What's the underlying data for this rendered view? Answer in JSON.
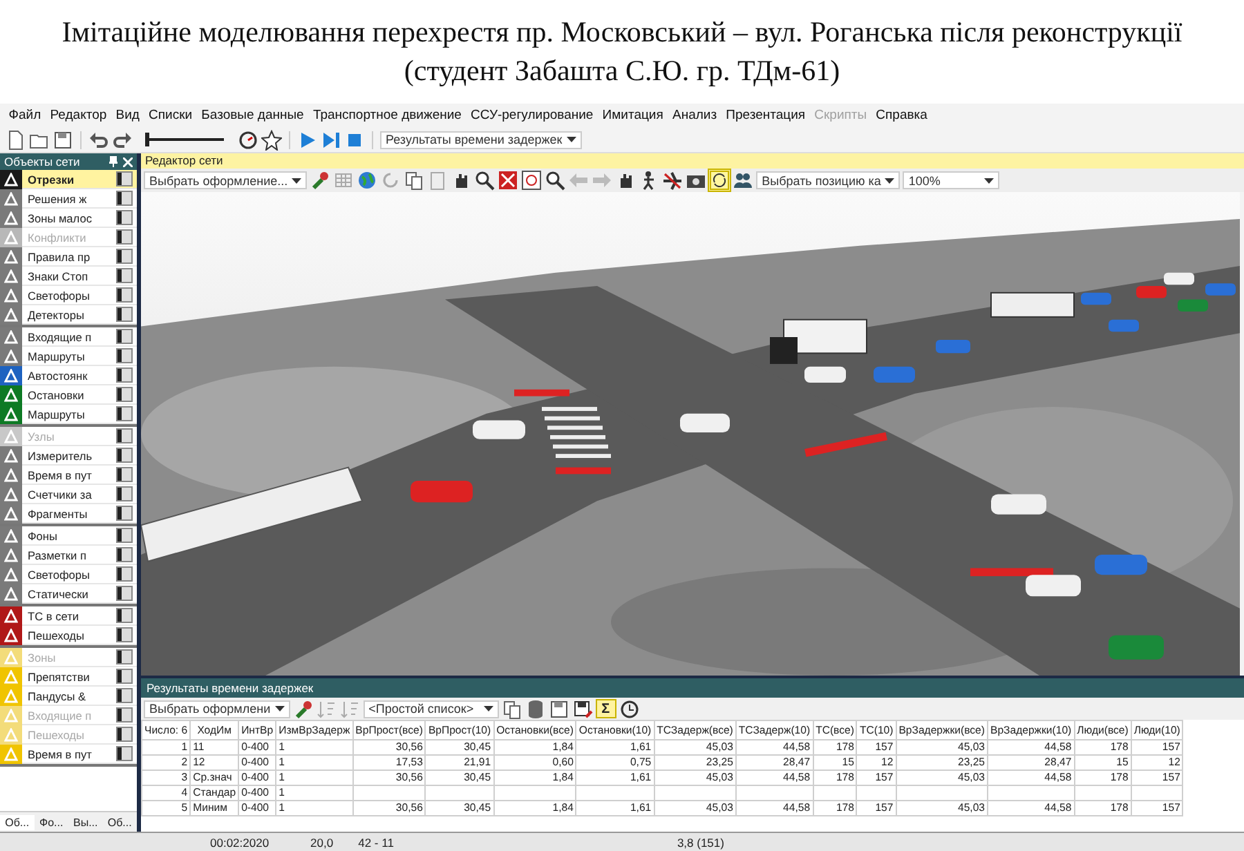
{
  "title": "Імітаційне моделювання перехрестя пр. Московський – вул. Роганська після реконструкції  (студент Забашта С.Ю. гр. ТДм-61)",
  "menu": [
    {
      "label": "Файл",
      "disabled": false
    },
    {
      "label": "Редактор",
      "disabled": false
    },
    {
      "label": "Вид",
      "disabled": false
    },
    {
      "label": "Списки",
      "disabled": false
    },
    {
      "label": "Базовые данные",
      "disabled": false
    },
    {
      "label": "Транспортное движение",
      "disabled": false
    },
    {
      "label": "ССУ-регулирование",
      "disabled": false
    },
    {
      "label": "Имитация",
      "disabled": false
    },
    {
      "label": "Анализ",
      "disabled": false
    },
    {
      "label": "Презентация",
      "disabled": false
    },
    {
      "label": "Скрипты",
      "disabled": true
    },
    {
      "label": "Справка",
      "disabled": false
    }
  ],
  "main_toolbar": {
    "simulation_speed": {
      "level": 0
    },
    "evaluation_dropdown": "Результаты времени задержек"
  },
  "network_objects": {
    "title": "Объекты сети",
    "groups": [
      {
        "items": [
          {
            "label": "Отрезки",
            "selected": true,
            "disabled": false,
            "color": "#1a1a1a"
          },
          {
            "label": "Решения ж",
            "selected": false,
            "disabled": false,
            "color": "#7a7a7a"
          },
          {
            "label": "Зоны малос",
            "selected": false,
            "disabled": false,
            "color": "#7a7a7a"
          },
          {
            "label": "Конфликти",
            "selected": false,
            "disabled": true,
            "color": "#b8b8b8"
          },
          {
            "label": "Правила пр",
            "selected": false,
            "disabled": false,
            "color": "#7a7a7a"
          },
          {
            "label": "Знаки Стоп",
            "selected": false,
            "disabled": false,
            "color": "#7a7a7a"
          },
          {
            "label": "Светофоры",
            "selected": false,
            "disabled": false,
            "color": "#7a7a7a"
          },
          {
            "label": "Детекторы",
            "selected": false,
            "disabled": false,
            "color": "#7a7a7a"
          }
        ]
      },
      {
        "items": [
          {
            "label": "Входящие п",
            "selected": false,
            "disabled": false,
            "color": "#7a7a7a"
          },
          {
            "label": "Маршруты",
            "selected": false,
            "disabled": false,
            "color": "#7a7a7a"
          },
          {
            "label": "Автостоянк",
            "selected": false,
            "disabled": false,
            "color": "#1e62c0"
          },
          {
            "label": "Остановки",
            "selected": false,
            "disabled": false,
            "color": "#0d7a24"
          },
          {
            "label": "Маршруты",
            "selected": false,
            "disabled": false,
            "color": "#0d7a24"
          }
        ]
      },
      {
        "items": [
          {
            "label": "Узлы",
            "selected": false,
            "disabled": true,
            "color": "#c8c8c8"
          },
          {
            "label": "Измеритель",
            "selected": false,
            "disabled": false,
            "color": "#7a7a7a"
          },
          {
            "label": "Время в пут",
            "selected": false,
            "disabled": false,
            "color": "#7a7a7a"
          },
          {
            "label": "Счетчики за",
            "selected": false,
            "disabled": false,
            "color": "#7a7a7a"
          },
          {
            "label": "Фрагменты",
            "selected": false,
            "disabled": false,
            "color": "#7a7a7a"
          }
        ]
      },
      {
        "items": [
          {
            "label": "Фоны",
            "selected": false,
            "disabled": false,
            "color": "#7a7a7a"
          },
          {
            "label": "Разметки п",
            "selected": false,
            "disabled": false,
            "color": "#7a7a7a"
          },
          {
            "label": "Светофоры",
            "selected": false,
            "disabled": false,
            "color": "#7a7a7a"
          },
          {
            "label": "Статически",
            "selected": false,
            "disabled": false,
            "color": "#7a7a7a"
          }
        ]
      },
      {
        "items": [
          {
            "label": "ТС в сети",
            "selected": false,
            "disabled": false,
            "color": "#b01818"
          },
          {
            "label": "Пешеходы",
            "selected": false,
            "disabled": false,
            "color": "#b01818"
          }
        ]
      },
      {
        "items": [
          {
            "label": "Зоны",
            "selected": false,
            "disabled": true,
            "color": "#f3dc7a"
          },
          {
            "label": "Препятстви",
            "selected": false,
            "disabled": false,
            "color": "#f0c400"
          },
          {
            "label": "Пандусы &",
            "selected": false,
            "disabled": false,
            "color": "#f0c400"
          },
          {
            "label": "Входящие п",
            "selected": false,
            "disabled": true,
            "color": "#f3dc7a"
          },
          {
            "label": "Пешеходы",
            "selected": false,
            "disabled": true,
            "color": "#f3dc7a"
          },
          {
            "label": "Время в пут",
            "selected": false,
            "disabled": false,
            "color": "#f0c400"
          }
        ]
      }
    ],
    "tabs": [
      {
        "label": "Об...",
        "selected": true
      },
      {
        "label": "Фо...",
        "selected": false
      },
      {
        "label": "Вы...",
        "selected": false
      },
      {
        "label": "Об...",
        "selected": false
      }
    ]
  },
  "network_editor": {
    "title": "Редактор сети",
    "style_dropdown": "Выбрать оформление...",
    "camera_dropdown": "Выбрать позицию ка",
    "zoom_dropdown": "100%",
    "sync_pressed": true
  },
  "results": {
    "title": "Результаты времени задержек",
    "style_dropdown": "Выбрать оформлени",
    "list_dropdown": "<Простой список>",
    "sum_button": {
      "label": "Σ",
      "pressed": true
    },
    "table": {
      "columns": [
        "Число: 6",
        "ХодИм",
        "ИнтВр",
        "ИзмВрЗадерж",
        "ВрПрост(все)",
        "ВрПрост(10)",
        "Остановки(все)",
        "Остановки(10)",
        "ТСЗадерж(все)",
        "ТСЗадерж(10)",
        "ТС(все)",
        "ТС(10)",
        "ВрЗадержки(все)",
        "ВрЗадержки(10)",
        "Люди(все)",
        "Люди(10)"
      ],
      "rows": [
        [
          "1",
          "11",
          "0-400",
          "1",
          "30,56",
          "30,45",
          "1,84",
          "1,61",
          "45,03",
          "44,58",
          "178",
          "157",
          "45,03",
          "44,58",
          "178",
          "157"
        ],
        [
          "2",
          "12",
          "0-400",
          "1",
          "17,53",
          "21,91",
          "0,60",
          "0,75",
          "23,25",
          "28,47",
          "15",
          "12",
          "23,25",
          "28,47",
          "15",
          "12"
        ],
        [
          "3",
          "Ср.знач",
          "0-400",
          "1",
          "30,56",
          "30,45",
          "1,84",
          "1,61",
          "45,03",
          "44,58",
          "178",
          "157",
          "45,03",
          "44,58",
          "178",
          "157"
        ],
        [
          "4",
          "Стандар",
          "0-400",
          "1"
        ],
        [
          "5",
          "Миним",
          "0-400",
          "1",
          "30,56",
          "30,45",
          "1,84",
          "1,61",
          "45,03",
          "44,58",
          "178",
          "157",
          "45,03",
          "44,58",
          "178",
          "157"
        ]
      ]
    }
  },
  "status_bar": [
    "00:02:2020",
    "20,0",
    "42 - 11",
    "3,8 (151)"
  ]
}
